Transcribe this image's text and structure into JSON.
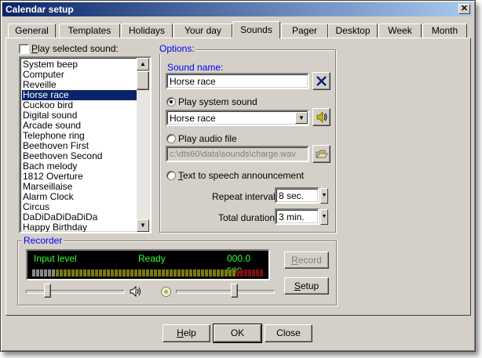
{
  "window": {
    "title": "Calendar setup"
  },
  "tabs": [
    "General",
    "Templates",
    "Holidays",
    "Your day",
    "Sounds",
    "Pager",
    "Desktop",
    "Week",
    "Month"
  ],
  "active_tab": "Sounds",
  "play_selected": {
    "label": "Play selected sound:",
    "checked": false
  },
  "sounds_list": {
    "items": [
      "System beep",
      "Computer",
      "Reveille",
      "Horse race",
      "Cuckoo bird",
      "Digital sound",
      "Arcade sound",
      "Telephone ring",
      "Beethoven First",
      "Beethoven Second",
      "Bach melody",
      "1812 Overture",
      "Marseillaise",
      "Alarm Clock",
      "Circus",
      "DaDiDaDiDaDiDa",
      "Happy Birthday"
    ],
    "selected": "Horse race"
  },
  "options": {
    "group_label": "Options:",
    "sound_name_label": "Sound name:",
    "sound_name_value": "Horse race",
    "play_system_label": "Play system sound",
    "system_sound_value": "Horse race",
    "play_audio_label": "Play audio file",
    "audio_file_value": "c:\\dts60\\data\\sounds\\charge.wav",
    "tts_label": "Text to speech announcement",
    "repeat_label": "Repeat interval:",
    "repeat_value": "8 sec.",
    "total_label": "Total duration:",
    "total_value": "3 min.",
    "selected_mode": "Play system sound"
  },
  "recorder": {
    "group_label": "Recorder",
    "input_level_label": "Input level",
    "status": "Ready",
    "time": "000.0 sec.",
    "record_label": "Record",
    "setup_label": "Setup",
    "volume_level": 0.22,
    "balance_level": 0.6
  },
  "buttons": {
    "help": "Help",
    "ok": "OK",
    "close": "Close"
  },
  "colors": {
    "title_start": "#0a246a",
    "title_end": "#a6caf0",
    "selection": "#0a246a",
    "vu_text": "#33ff33",
    "vu_bg": "#000000",
    "link_blue": "#0000ff"
  }
}
